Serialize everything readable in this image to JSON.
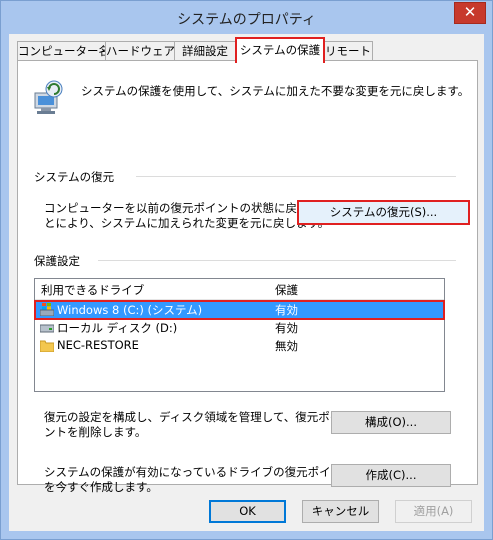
{
  "window": {
    "title": "システムのプロパティ",
    "close_glyph": "✕"
  },
  "tabs": [
    {
      "label": "コンピューター名"
    },
    {
      "label": "ハードウェア"
    },
    {
      "label": "詳細設定"
    },
    {
      "label": "システムの保護",
      "active": true
    },
    {
      "label": "リモート"
    }
  ],
  "intro": {
    "text": "システムの保護を使用して、システムに加えた不要な変更を元に戻します。",
    "icon": "system-protection-icon"
  },
  "restore": {
    "group_label": "システムの復元",
    "desc_line1": "コンピューターを以前の復元ポイントの状態に戻すこ",
    "desc_line2": "とにより、システムに加えられた変更を元に戻します。",
    "button_label": "システムの復元(S)..."
  },
  "protection": {
    "group_label": "保護設定",
    "columns": {
      "drive": "利用できるドライブ",
      "protection": "保護"
    },
    "drives": [
      {
        "name": "Windows 8 (C:) (システム)",
        "protection": "有効",
        "icon": "system-drive-icon",
        "selected": true
      },
      {
        "name": "ローカル ディスク (D:)",
        "protection": "有効",
        "icon": "local-disk-icon"
      },
      {
        "name": "NEC-RESTORE",
        "protection": "無効",
        "icon": "folder-icon"
      }
    ],
    "configure_desc_line1": "復元の設定を構成し、ディスク領域を管理して、復元ポイ",
    "configure_desc_line2": "ントを削除します。",
    "configure_label": "構成(O)...",
    "create_desc_line1": "システムの保護が有効になっているドライブの復元ポイント",
    "create_desc_line2": "を今すぐ作成します。",
    "create_label": "作成(C)..."
  },
  "footer": {
    "ok_label": "OK",
    "cancel_label": "キャンセル",
    "apply_label": "適用(A)"
  },
  "colors": {
    "highlight": "#e02020",
    "selection": "#3399ff",
    "titlebar": "#a9c6ee"
  }
}
